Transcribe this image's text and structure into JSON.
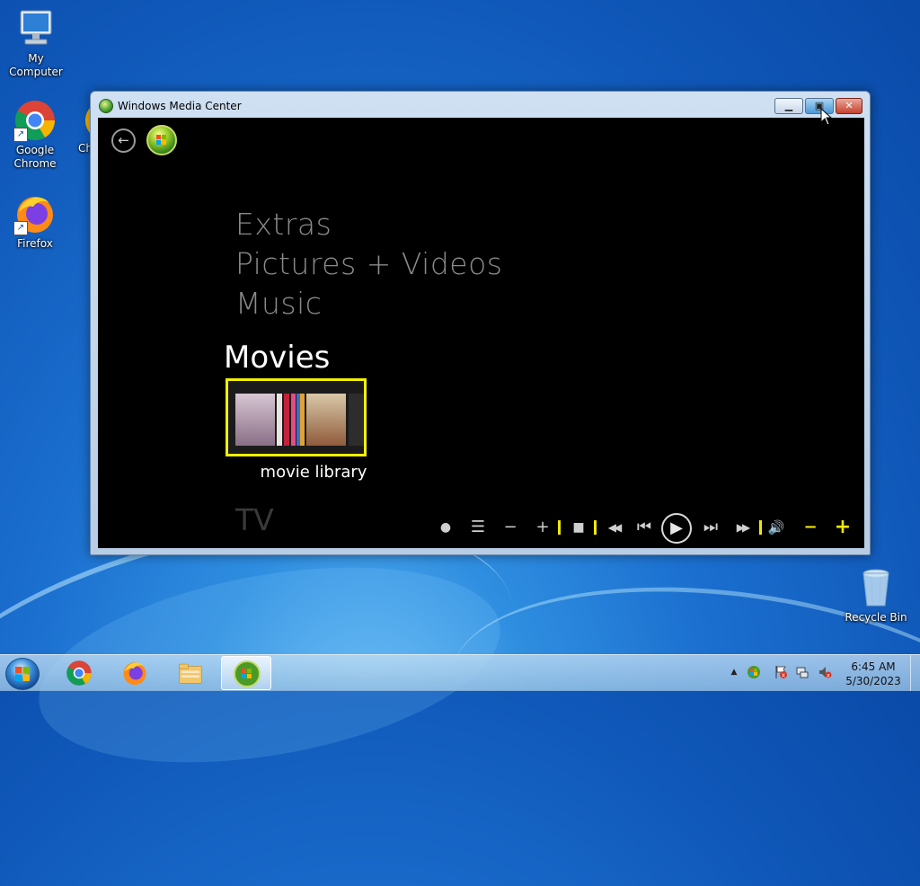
{
  "desktop": {
    "icons": [
      {
        "label": "My Computer"
      },
      {
        "label": "Google Chrome"
      },
      {
        "label": "Firefox"
      },
      {
        "label": "Recycle Bin"
      }
    ],
    "partial_icon_label": "Ch"
  },
  "window": {
    "title": "Windows Media Center",
    "buttons": {
      "minimize": "▁",
      "restore": "▣",
      "close": "✕"
    }
  },
  "media_center": {
    "back_glyph": "←",
    "menu": {
      "items_above": [
        "Extras",
        "Pictures + Videos",
        "Music"
      ],
      "current": "Movies",
      "tile_label": "movie library",
      "next": "TV"
    },
    "controls": {
      "record": "●",
      "guide": "☰",
      "channel_down": "−",
      "channel_up": "+",
      "stop": "■",
      "rewind": "◀◀",
      "prev": "⏮",
      "play": "▶",
      "next": "⏭",
      "fast_forward": "▶▶",
      "volume": "🔊",
      "vol_down": "−",
      "vol_up": "+"
    }
  },
  "taskbar": {
    "apps": [
      "Google Chrome",
      "Firefox",
      "Windows Explorer",
      "Windows Media Center"
    ],
    "tray": {
      "overflow": "▲",
      "time": "6:45 AM",
      "date": "5/30/2023"
    }
  },
  "colors": {
    "highlight": "#f3f000",
    "menu_inactive": "#8a8a8a",
    "menu_active": "#ffffff"
  }
}
